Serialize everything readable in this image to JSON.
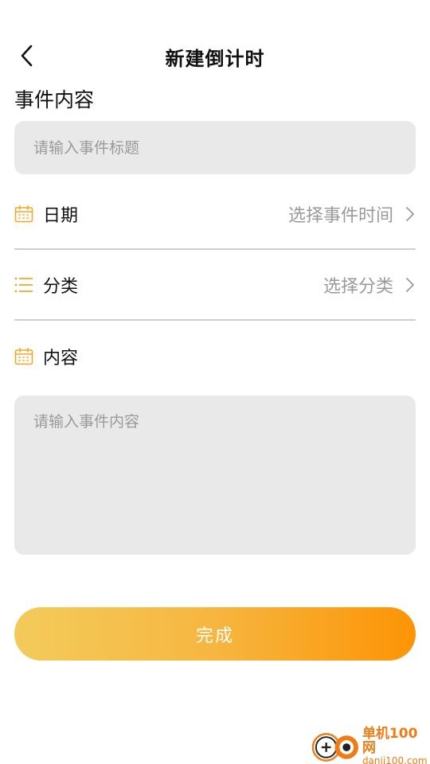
{
  "header": {
    "back_icon": "chevron-left-icon",
    "title": "新建倒计时"
  },
  "event_section": {
    "label": "事件内容",
    "title_placeholder": "请输入事件标题",
    "title_value": ""
  },
  "rows": {
    "date": {
      "icon": "calendar-icon",
      "label": "日期",
      "value": "选择事件时间",
      "arrow_icon": "chevron-right-icon"
    },
    "category": {
      "icon": "list-icon",
      "label": "分类",
      "value": "选择分类",
      "arrow_icon": "chevron-right-icon"
    },
    "content": {
      "icon": "calendar-icon",
      "label": "内容"
    }
  },
  "content_input": {
    "placeholder": "请输入事件内容",
    "value": ""
  },
  "done_button": {
    "label": "完成"
  },
  "watermark": {
    "name": "单机100网",
    "url": "danji100.com"
  },
  "colors": {
    "accent": "#fd9405",
    "accent_light": "#f3cb5b",
    "input_bg": "#e9e9e9",
    "placeholder": "#9a9a9a",
    "divider": "#cfcfcf"
  }
}
